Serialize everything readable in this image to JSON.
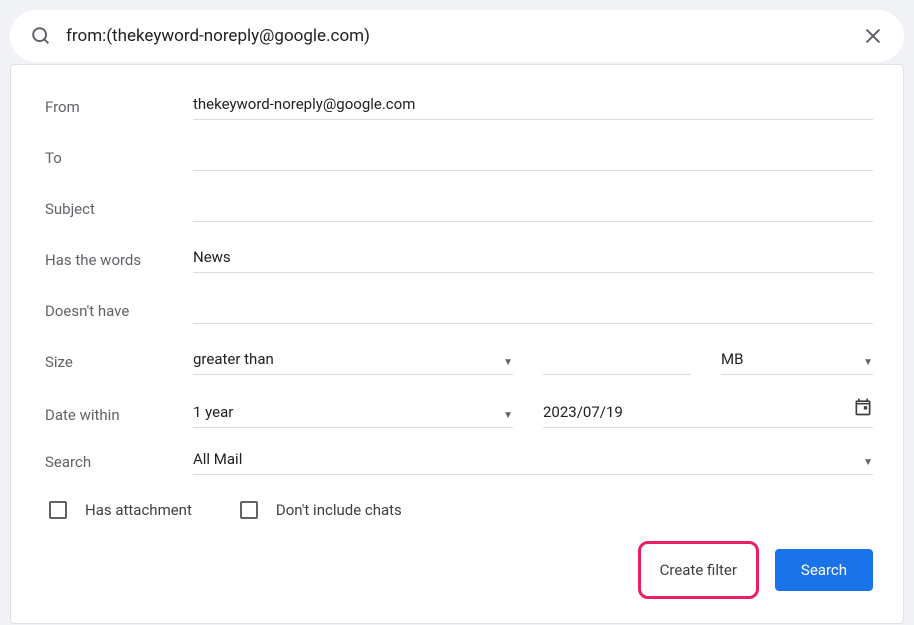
{
  "searchBar": {
    "value": "from:(thekeyword-noreply@google.com)"
  },
  "form": {
    "from": {
      "label": "From",
      "value": "thekeyword-noreply@google.com"
    },
    "to": {
      "label": "To",
      "value": ""
    },
    "subject": {
      "label": "Subject",
      "value": ""
    },
    "hasWords": {
      "label": "Has the words",
      "value": "News"
    },
    "doesntHave": {
      "label": "Doesn't have",
      "value": ""
    },
    "size": {
      "label": "Size",
      "operator": "greater than",
      "value": "",
      "unit": "MB"
    },
    "dateWithin": {
      "label": "Date within",
      "range": "1 year",
      "date": "2023/07/19"
    },
    "search": {
      "label": "Search",
      "value": "All Mail"
    },
    "checkboxes": {
      "hasAttachment": {
        "label": "Has attachment",
        "checked": false
      },
      "dontIncludeChats": {
        "label": "Don't include chats",
        "checked": false
      }
    }
  },
  "buttons": {
    "createFilter": "Create filter",
    "search": "Search"
  }
}
